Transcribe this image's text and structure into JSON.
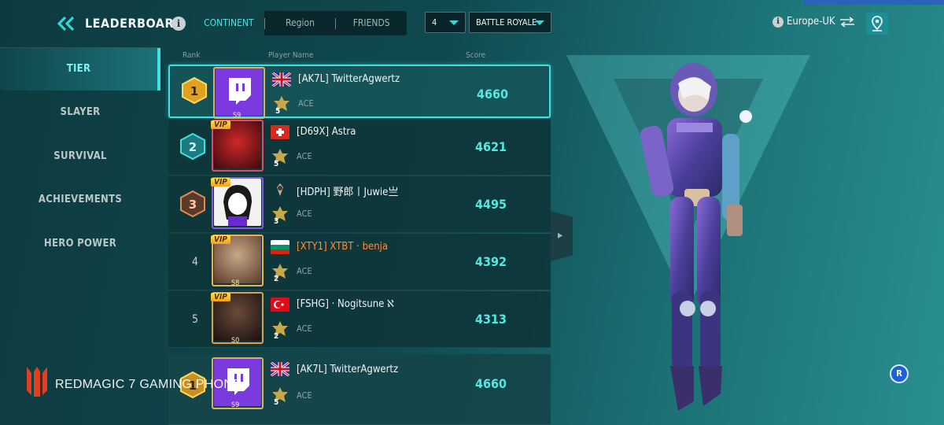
{
  "header": {
    "title": "LEADERBOARD",
    "info_icon": "i",
    "tabs": [
      {
        "label": "CONTINENT",
        "active": true
      },
      {
        "label": "Region",
        "active": false
      },
      {
        "label": "FRIENDS",
        "active": false
      }
    ],
    "count_select": "4",
    "mode_select": "BATTLE ROYALE",
    "region": "Europe-UK",
    "region_info": "i"
  },
  "sidebar": {
    "items": [
      {
        "label": "TIER",
        "active": true
      },
      {
        "label": "SLAYER",
        "active": false
      },
      {
        "label": "SURVIVAL",
        "active": false
      },
      {
        "label": "ACHIEVEMENTS",
        "active": false
      },
      {
        "label": "HERO POWER",
        "active": false
      }
    ]
  },
  "table": {
    "columns": {
      "rank": "Rank",
      "player": "Player Name",
      "score": "Score"
    },
    "rows": [
      {
        "rank": "1",
        "name": "[AK7L] TwitterAgwertz",
        "tier": "ACE",
        "tier_level": "5",
        "score": "4660",
        "season": "S9",
        "flag": "uk",
        "vip": false,
        "avatar": "twitch-logo"
      },
      {
        "rank": "2",
        "name": "[D69X] Astra",
        "tier": "ACE",
        "tier_level": "5",
        "score": "4621",
        "season": "",
        "flag": "switzerland",
        "vip": true,
        "avatar": "player-photo"
      },
      {
        "rank": "3",
        "name": "[HDPH] 野郎丨Juwie亗",
        "tier": "ACE",
        "tier_level": "3",
        "score": "4495",
        "season": "",
        "flag": "clan-emblem",
        "vip": true,
        "avatar": "anime-portrait"
      },
      {
        "rank": "4",
        "name": "[XTY1] XTBT · benja",
        "tier": "ACE",
        "tier_level": "2",
        "score": "4392",
        "season": "S8",
        "flag": "bulgaria",
        "vip": true,
        "avatar": "player-photo"
      },
      {
        "rank": "5",
        "name": "[FSHG]  · Nogitsune ℵ",
        "tier": "ACE",
        "tier_level": "2",
        "score": "4313",
        "season": "S0",
        "flag": "turkey",
        "vip": true,
        "avatar": "player-photo"
      }
    ],
    "self_row": {
      "rank": "1",
      "name": "[AK7L] TwitterAgwertz",
      "tier": "ACE",
      "tier_level": "5",
      "score": "4660",
      "season": "S9",
      "flag": "uk"
    }
  },
  "watermark": "REDMAGIC 7 GAMING PHONE",
  "r_button": "R",
  "colors": {
    "accent": "#3fe0e0",
    "score": "#54e8e2",
    "vip": "#ffc830",
    "orange_name": "#ff8a3a"
  }
}
